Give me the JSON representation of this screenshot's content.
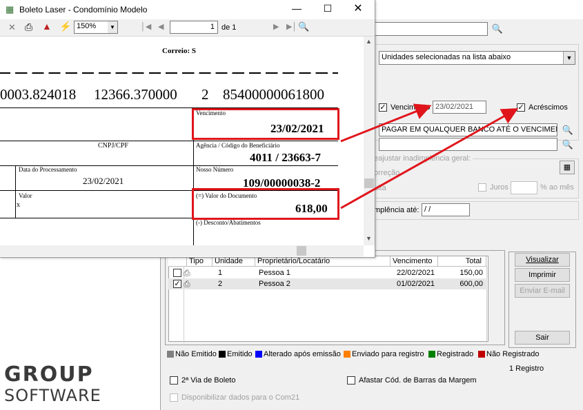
{
  "preview": {
    "title": "Boleto Laser - Condomínio Modelo",
    "zoom": "150%",
    "page_number": "1",
    "page_of": "de 1"
  },
  "boleto": {
    "correio": "Correio: S",
    "barcode_line": {
      "part1": "0003.824018",
      "part2": "12366.370000",
      "part3": "2",
      "part4": "85400000061800"
    },
    "vencimento_label": "Vencimento",
    "vencimento_value": "23/02/2021",
    "cnpj_label": "CNPJ/CPF",
    "agencia_label": "Agência / Código do Beneficiário",
    "agencia_value": "4011 / 23663-7",
    "data_processamento_label": "Data do Processamento",
    "data_processamento_value": "23/02/2021",
    "nosso_numero_label": "Nosso Número",
    "nosso_numero_value": "109/00000038-2",
    "valor_label": "Valor",
    "valor_x": "x",
    "valor_documento_label": "(=) Valor do Documento",
    "valor_documento_value": "618,00",
    "desconto_label": "(-) Desconto/Abatimentos"
  },
  "form": {
    "selection_dropdown": "Unidades selecionadas na lista abaixo",
    "vencimento_check_label": "Vencimento",
    "vencimento_date": "23/02/2021",
    "acrescimos_label": "Acréscimos",
    "instrucao_1": "PAGAR EM QUALQUER BANCO ATÉ O VENCIMENTO",
    "instrucao_2": "",
    "reajustar_label": "eajustar inadimplência geral:",
    "correcao_label": "orreção",
    "multa_label": "ulta",
    "juros_label": "Juros",
    "juros_unit": "% ao mês",
    "inadimplencia_label": "mplência até:",
    "inadimplencia_date": " / /"
  },
  "table": {
    "headers": [
      "Tipo",
      "Unidade",
      "Proprietário/Locatário",
      "Vencimento",
      "Total"
    ],
    "rows": [
      {
        "checked": false,
        "unidade": "1",
        "nome": "Pessoa 1",
        "vencimento": "22/02/2021",
        "total": "150,00"
      },
      {
        "checked": true,
        "unidade": "2",
        "nome": "Pessoa 2",
        "vencimento": "01/02/2021",
        "total": "600,00"
      }
    ]
  },
  "buttons": {
    "visualizar": "Visualizar",
    "imprimir": "Imprimir",
    "enviar_email": "Enviar E-mail",
    "sair": "Sair"
  },
  "legend": [
    {
      "label": "Não Emitido",
      "color": "#808080"
    },
    {
      "label": "Emitido",
      "color": "#000000"
    },
    {
      "label": "Alterado após emissão",
      "color": "#0000ff"
    },
    {
      "label": "Enviado para registro",
      "color": "#ff8000"
    },
    {
      "label": "Registrado",
      "color": "#008000"
    },
    {
      "label": "Não Registrado",
      "color": "#c00000"
    }
  ],
  "registro_count": "1 Registro",
  "segunda_via_label": "2ª Via de Boleto",
  "afastar_label": "Afastar Cód. de Barras da Margem",
  "disponibilizar_label": "Disponibilizar dados para o Com21",
  "logo": {
    "line1": "GROUP",
    "line2": "SOFTWARE"
  },
  "accent_red": "#e0151b"
}
